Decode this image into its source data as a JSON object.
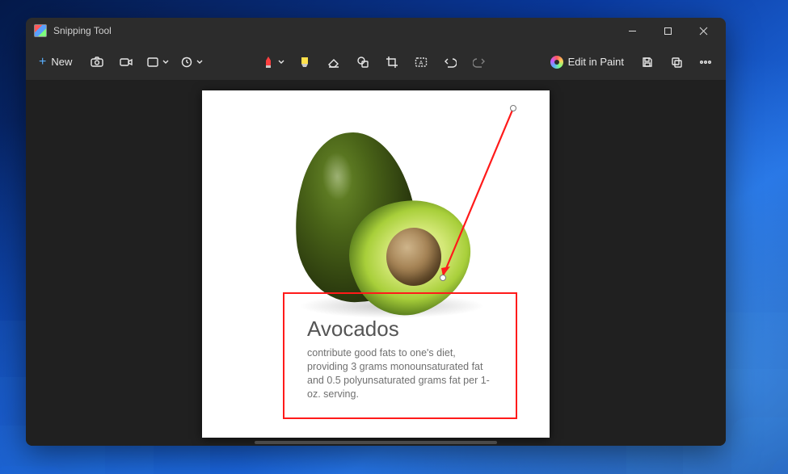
{
  "window": {
    "title": "Snipping Tool"
  },
  "toolbar": {
    "new_label": "New",
    "edit_in_paint_label": "Edit in Paint"
  },
  "snip": {
    "caption_title": "Avocados",
    "caption_body": "contribute good fats to one's diet, providing 3 grams monounsaturated fat and 0.5 polyunsaturated grams fat per 1-oz. serving."
  }
}
